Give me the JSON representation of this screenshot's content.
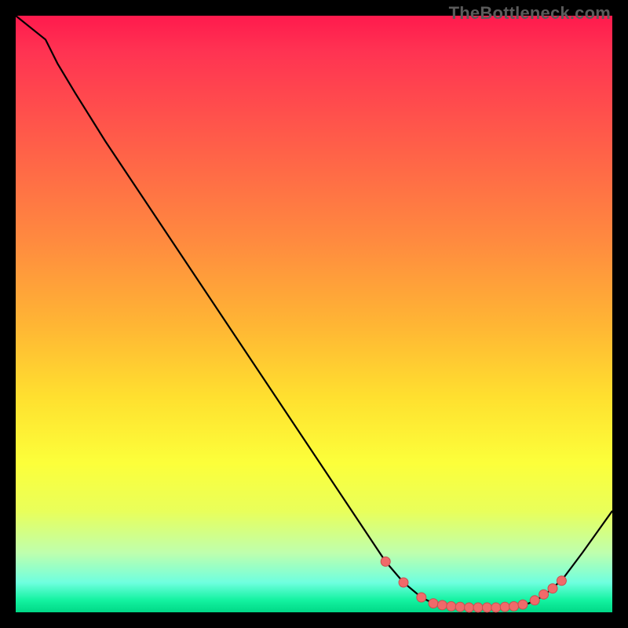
{
  "watermark": "TheBottleneck.com",
  "colors": {
    "background": "#000000",
    "curve": "#000000",
    "marker_fill": "#f06a6a",
    "marker_stroke": "#c94f4f"
  },
  "chart_data": {
    "type": "line",
    "title": "",
    "xlabel": "",
    "ylabel": "",
    "xlim": [
      0,
      100
    ],
    "ylim": [
      0,
      100
    ],
    "grid": false,
    "legend": false,
    "x": [
      0,
      5,
      7,
      10,
      15,
      20,
      25,
      30,
      35,
      40,
      45,
      50,
      55,
      60,
      62,
      65,
      68,
      70,
      72,
      74,
      76,
      78,
      80,
      82,
      84,
      86,
      88,
      90,
      92,
      95,
      100
    ],
    "values": [
      100,
      96,
      92,
      87,
      79,
      71.5,
      64,
      56.5,
      49,
      41.5,
      34,
      26.5,
      19,
      11.5,
      8.5,
      5,
      2.5,
      1.5,
      1,
      0.8,
      0.7,
      0.7,
      0.7,
      0.8,
      1,
      1.5,
      2.5,
      4,
      6,
      10,
      17
    ],
    "markers": {
      "x": [
        62,
        65,
        68,
        70,
        71.5,
        73,
        74.5,
        76,
        77.5,
        79,
        80.5,
        82,
        83.5,
        85,
        87,
        88.5,
        90,
        91.5
      ],
      "y": [
        8.5,
        5,
        2.5,
        1.5,
        1.2,
        1.0,
        0.9,
        0.8,
        0.8,
        0.8,
        0.8,
        0.9,
        1.0,
        1.3,
        2.0,
        3.0,
        4.0,
        5.3
      ]
    }
  }
}
